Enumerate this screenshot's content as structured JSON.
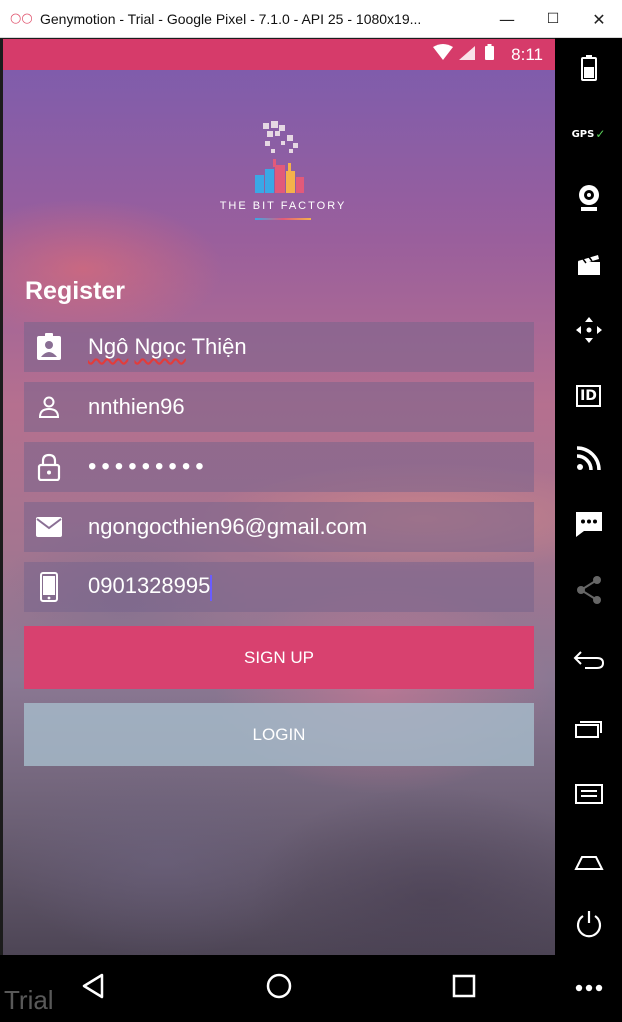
{
  "window": {
    "title": "Genymotion - Trial - Google Pixel - 7.1.0 - API 25 - 1080x19...",
    "minimize": "—",
    "maximize": "☐",
    "close": "✕"
  },
  "status_bar": {
    "time": "8:11"
  },
  "brand": {
    "name": "THE BIT FACTORY"
  },
  "form": {
    "heading": "Register",
    "fullname": "Ngô Ngọc Thiện",
    "fullname_word1": "Ngô",
    "fullname_word2": "Ngọc",
    "fullname_word3": "Thiện",
    "username": "nnthien96",
    "password_mask": "•••••••••",
    "email": "ngongocthien96@gmail.com",
    "phone": "0901328995"
  },
  "buttons": {
    "signup": "SIGN UP",
    "login": "LOGIN"
  },
  "watermark": "Trial",
  "colors": {
    "accent": "#d63b6a",
    "signup_bg": "#d8416f",
    "login_bg": "#a5b9c8"
  },
  "sidebar_icons": [
    "battery-icon",
    "gps-icon",
    "webcam-icon",
    "video-capture-icon",
    "navigation-icon",
    "id-icon",
    "remote-control-icon",
    "sms-icon",
    "share-icon",
    "back-icon",
    "recent-apps-icon",
    "menu-icon",
    "home-icon",
    "power-icon",
    "more-icon"
  ],
  "sidebar_labels": {
    "gps": "GPS",
    "id": "ID"
  }
}
